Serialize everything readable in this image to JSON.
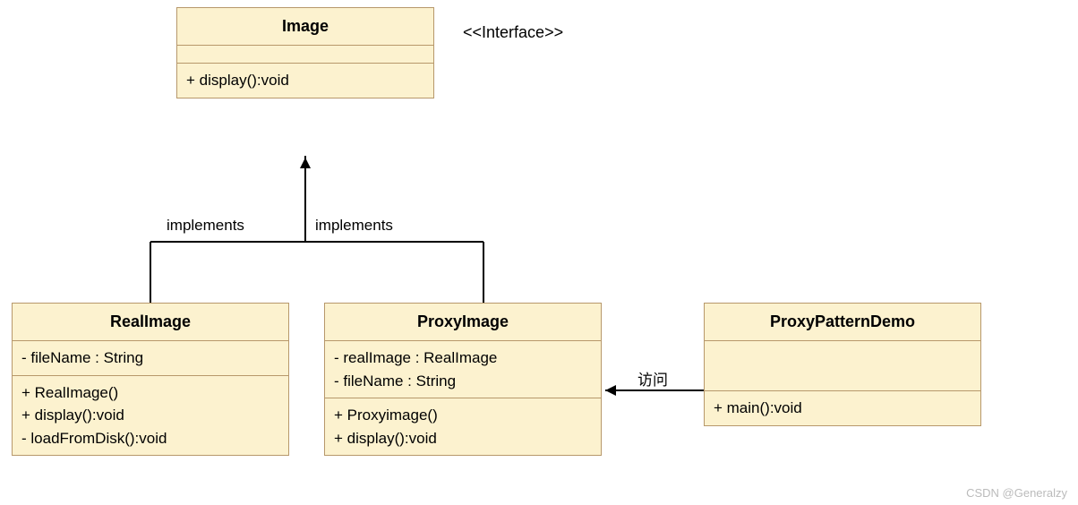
{
  "classes": {
    "image": {
      "name": "Image",
      "stereotype": "<<Interface>>",
      "methods": [
        "+ display():void"
      ]
    },
    "realImage": {
      "name": "RealImage",
      "attributes": [
        "- fileName : String"
      ],
      "methods": [
        "+ RealImage()",
        "+ display():void",
        "- loadFromDisk():void"
      ]
    },
    "proxyImage": {
      "name": "ProxyImage",
      "attributes": [
        "- realImage : RealImage",
        "- fileName : String"
      ],
      "methods": [
        "+ Proxyimage()",
        "+ display():void"
      ]
    },
    "proxyPatternDemo": {
      "name": "ProxyPatternDemo",
      "methods": [
        "+ main():void"
      ]
    }
  },
  "relations": {
    "implementsLeft": "implements",
    "implementsRight": "implements",
    "access": "访问"
  },
  "watermark": "CSDN @Generalzy",
  "colors": {
    "boxFill": "#FCF2CF",
    "boxBorder": "#B7986B",
    "line": "#000000"
  }
}
